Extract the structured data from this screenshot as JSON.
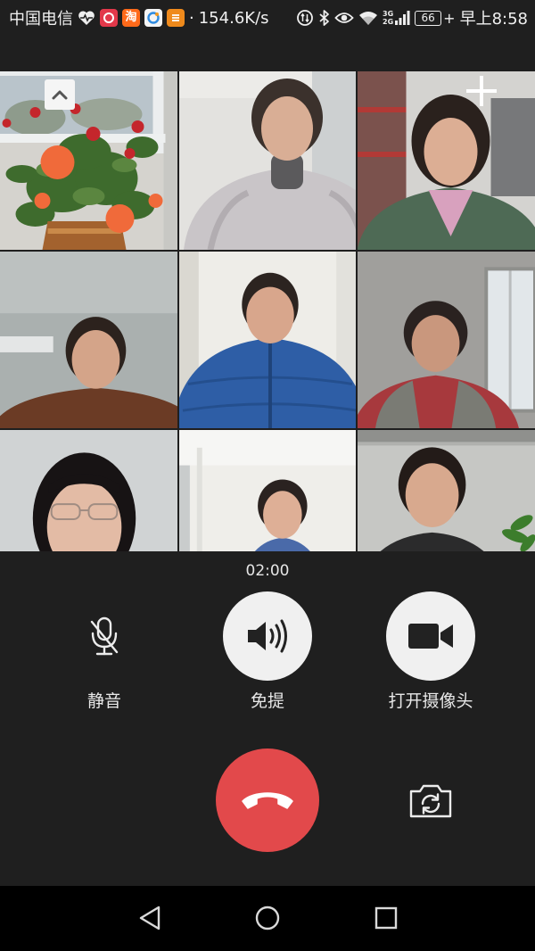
{
  "status_bar": {
    "carrier": "中国电信",
    "notification_icons": [
      "health-heart-icon",
      "app-notification-icon",
      "taobao-icon",
      "browser-icon",
      "app-icon-orange"
    ],
    "taobao_logo_text": "淘",
    "separator": "·",
    "net_speed": "154.6K/s",
    "system_icons": [
      "data-saver-icon",
      "bluetooth-icon",
      "eye-comfort-icon",
      "wifi-icon",
      "mobile-signal-icon",
      "battery-icon"
    ],
    "network_types": [
      "3G",
      "2G"
    ],
    "battery_level": "66",
    "charging_indicator": "+",
    "time": "早上8:58"
  },
  "video_grid": {
    "collapse_button_icon": "chevron-up-icon",
    "add_member_icon": "plus-icon"
  },
  "call": {
    "duration": "02:00",
    "controls": [
      {
        "label": "静音",
        "icon": "mic-off-icon"
      },
      {
        "label": "免提",
        "icon": "speaker-icon"
      },
      {
        "label": "打开摄像头",
        "icon": "video-camera-icon"
      }
    ],
    "actions": {
      "hang_up_icon": "hang-up-icon",
      "switch_camera_icon": "switch-camera-icon"
    }
  },
  "nav_bar": {
    "icons": [
      "back-icon",
      "home-icon",
      "recents-icon"
    ]
  },
  "colors": {
    "background": "#1f1f1f",
    "nav_bar": "#000000",
    "hang_up": "#e2494b",
    "control_button": "#f0f0f0",
    "text": "#ececec"
  }
}
